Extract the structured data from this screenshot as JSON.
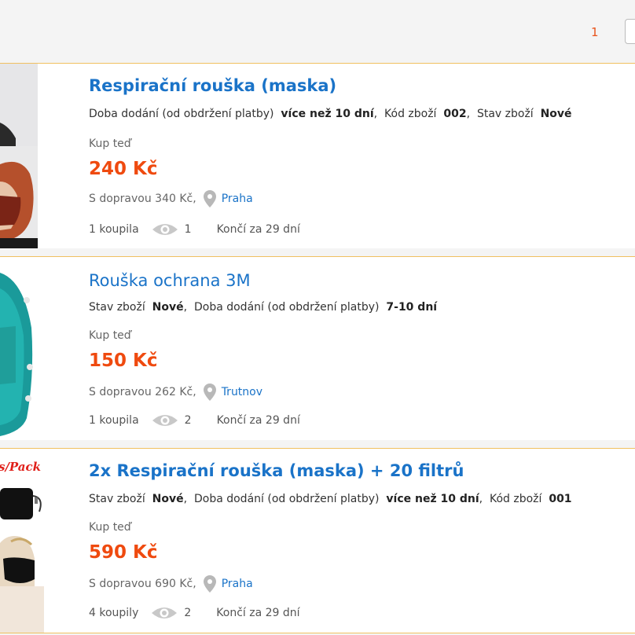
{
  "pagination": {
    "current_page": "1"
  },
  "listings": [
    {
      "title": "Respirační rouška (maska)",
      "meta": [
        {
          "label": "Doba dodání (od obdržení platby)",
          "value": "více než 10 dní"
        },
        {
          "label": "Kód zboží",
          "value": "002"
        },
        {
          "label": "Stav zboží",
          "value": "Nové"
        }
      ],
      "buy_label": "Kup teď",
      "price": "240 Kč",
      "shipping": "S dopravou 340 Kč,",
      "city": "Praha",
      "bought": "1 koupila",
      "views": "1",
      "ends": "Končí za 29 dní"
    },
    {
      "title": "Rouška ochrana 3M",
      "meta": [
        {
          "label": "Stav zboží",
          "value": "Nové"
        },
        {
          "label": "Doba dodání (od obdržení platby)",
          "value": "7-10 dní"
        }
      ],
      "buy_label": "Kup teď",
      "price": "150 Kč",
      "shipping": "S dopravou 262 Kč,",
      "city": "Trutnov",
      "bought": "1 koupila",
      "views": "2",
      "ends": "Končí za 29 dní"
    },
    {
      "title": "2x Respirační rouška (maska) + 20 filtrů",
      "thumb_text": "s/Pack",
      "meta": [
        {
          "label": "Stav zboží",
          "value": "Nové"
        },
        {
          "label": "Doba dodání (od obdržení platby)",
          "value": "více než 10 dní"
        },
        {
          "label": "Kód zboží",
          "value": "001"
        }
      ],
      "buy_label": "Kup teď",
      "price": "590 Kč",
      "shipping": "S dopravou 690 Kč,",
      "city": "Praha",
      "bought": "4 koupily",
      "views": "2",
      "ends": "Končí za 29 dní"
    }
  ]
}
